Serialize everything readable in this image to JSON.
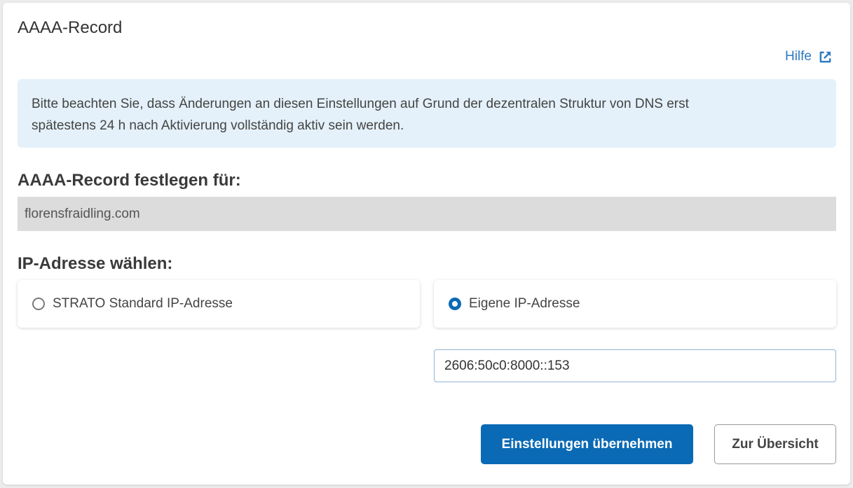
{
  "header": {
    "title": "AAAA-Record",
    "help_label": "Hilfe",
    "help_icon": "external-link-icon"
  },
  "notice": {
    "text_line1": "Bitte beachten Sie, dass Änderungen an diesen Einstellungen auf Grund der dezentralen Struktur von DNS erst",
    "text_line2": "spätestens 24 h nach Aktivierung vollständig aktiv sein werden."
  },
  "domain_section": {
    "label": "AAAA-Record festlegen für:",
    "value": "florensfraidling.com"
  },
  "ip_section": {
    "label": "IP-Adresse wählen:",
    "options": [
      {
        "label": "STRATO Standard IP-Adresse",
        "selected": false
      },
      {
        "label": "Eigene IP-Adresse",
        "selected": true
      }
    ],
    "custom_ip_value": "2606:50c0:8000::153"
  },
  "actions": {
    "apply_label": "Einstellungen übernehmen",
    "overview_label": "Zur Übersicht"
  },
  "colors": {
    "accent": "#0a6ab5",
    "link": "#2f7bc1",
    "notice_bg": "#e4f1fa",
    "readonly_bg": "#dcdcdc"
  }
}
